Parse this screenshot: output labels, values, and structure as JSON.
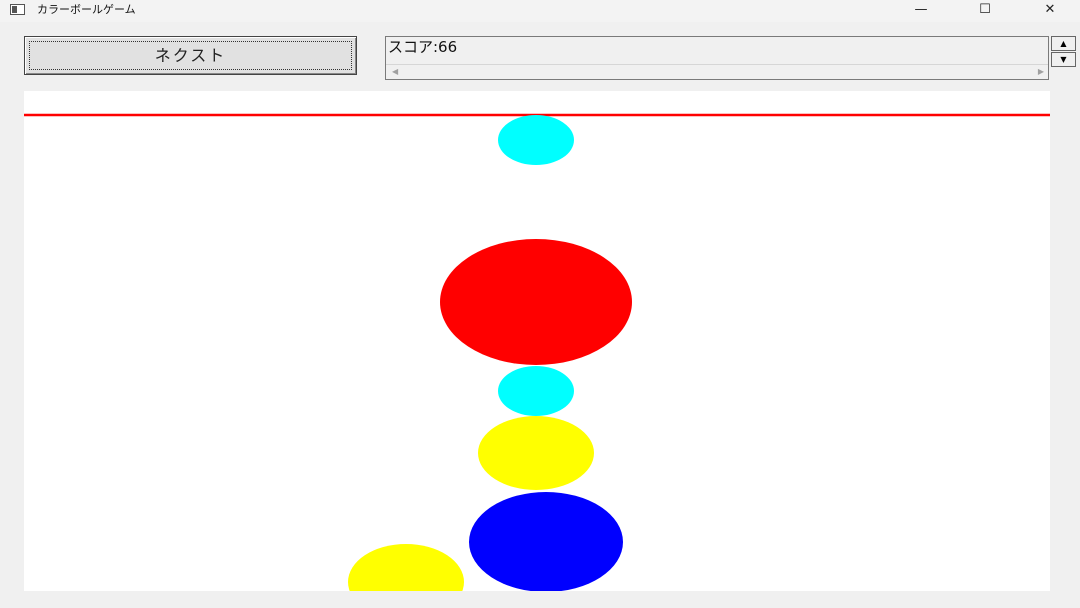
{
  "window": {
    "title": "カラーボールゲーム",
    "minimize_glyph": "—",
    "maximize_glyph": "☐",
    "close_glyph": "✕"
  },
  "controls": {
    "next_label": "ネクスト"
  },
  "score": {
    "text": "スコア:66"
  },
  "spinner": {
    "up_glyph": "▲",
    "down_glyph": "▼"
  },
  "scrollbar": {
    "left_glyph": "◀",
    "right_glyph": "▶"
  },
  "colors": {
    "limit_line": "#ff0000",
    "cyan": "#00ffff",
    "red": "#ff0000",
    "yellow": "#ffff00",
    "blue": "#0000ff"
  },
  "balls": [
    {
      "name": "cyan-ball-top",
      "color": "cyan"
    },
    {
      "name": "red-ball",
      "color": "red"
    },
    {
      "name": "cyan-ball-middle",
      "color": "cyan"
    },
    {
      "name": "yellow-ball-middle",
      "color": "yellow"
    },
    {
      "name": "blue-ball",
      "color": "blue"
    },
    {
      "name": "yellow-ball-left",
      "color": "yellow"
    }
  ]
}
